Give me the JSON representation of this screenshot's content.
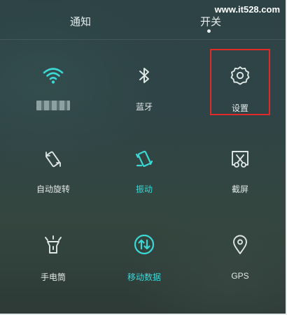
{
  "status_bar": {
    "watermark": "www.it528.com"
  },
  "tabs": [
    {
      "label": "通知",
      "active": false
    },
    {
      "label": "开关",
      "active": true
    }
  ],
  "colors": {
    "accent": "#3cd8d6",
    "text": "#e3e9e9",
    "highlight_box": "#e02a2a"
  },
  "tiles": [
    {
      "id": "wifi",
      "icon": "wifi-icon",
      "label": "",
      "active": true,
      "label_obscured": true
    },
    {
      "id": "bluetooth",
      "icon": "bluetooth-icon",
      "label": "蓝牙",
      "active": false
    },
    {
      "id": "settings",
      "icon": "gear-icon",
      "label": "设置",
      "active": false,
      "highlighted": true
    },
    {
      "id": "auto_rotate",
      "icon": "auto-rotate-icon",
      "label": "自动旋转",
      "active": false
    },
    {
      "id": "vibrate",
      "icon": "vibrate-icon",
      "label": "振动",
      "active": true
    },
    {
      "id": "screenshot",
      "icon": "screenshot-scissors-icon",
      "label": "截屏",
      "active": false
    },
    {
      "id": "flashlight",
      "icon": "flashlight-icon",
      "label": "手电筒",
      "active": false
    },
    {
      "id": "mobile_data",
      "icon": "mobile-data-icon",
      "label": "移动数据",
      "active": true
    },
    {
      "id": "gps",
      "icon": "location-pin-icon",
      "label": "GPS",
      "active": false
    }
  ]
}
